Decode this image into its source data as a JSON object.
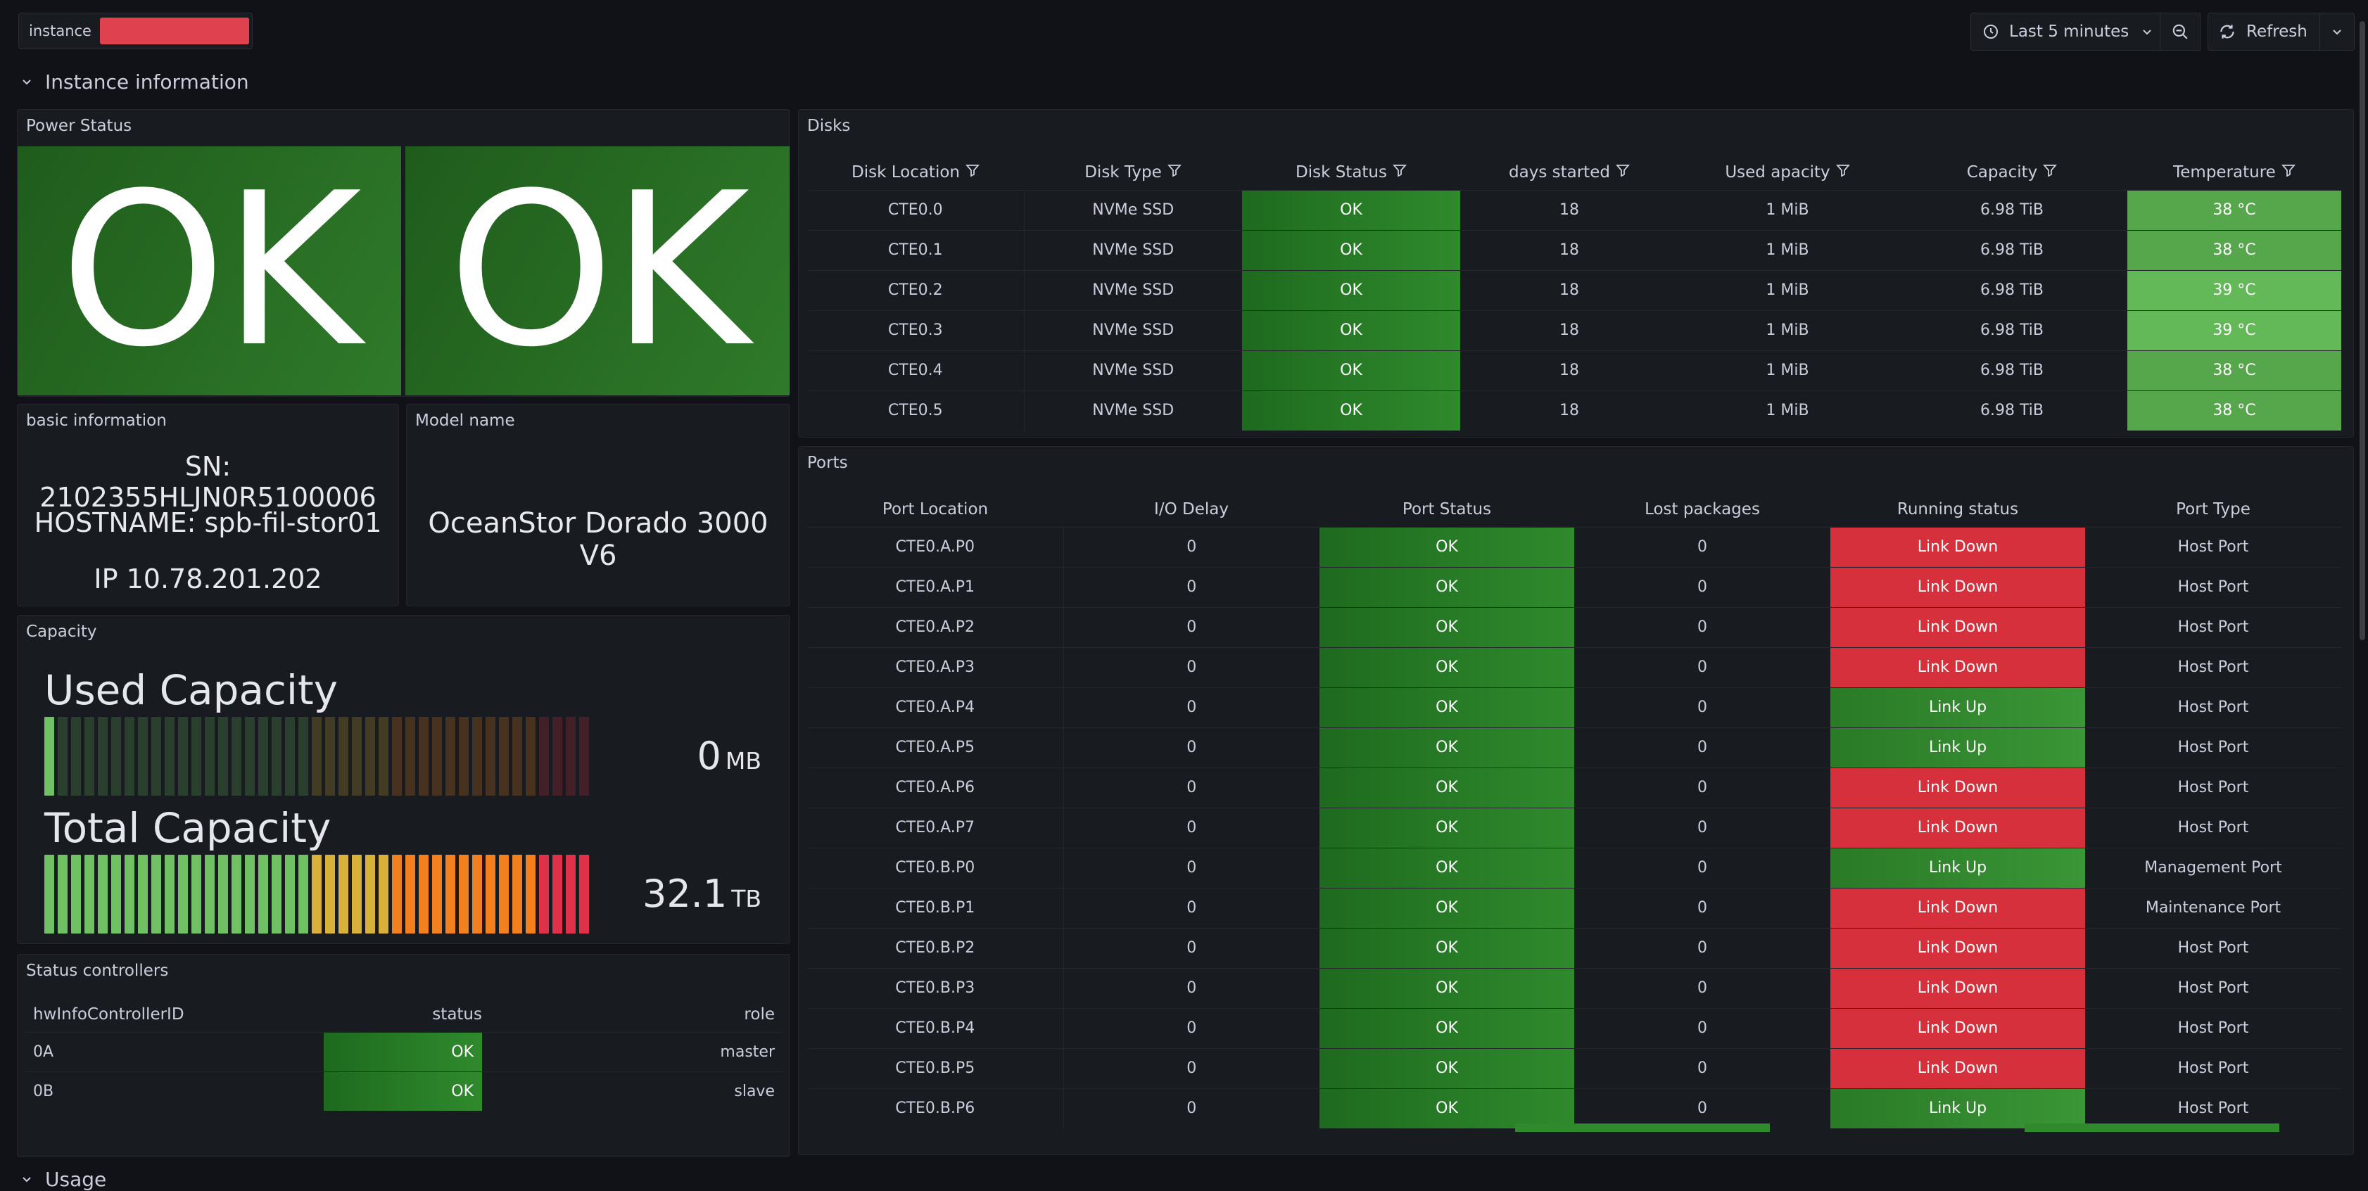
{
  "toolbar": {
    "variable_label": "instance",
    "time_range_label": "Last 5 minutes",
    "refresh_label": "Refresh"
  },
  "row": {
    "title": "Instance information",
    "next_title": "Usage"
  },
  "power_status": {
    "title": "Power Status",
    "tiles": [
      "OK",
      "OK"
    ]
  },
  "basic_info": {
    "title": "basic information",
    "sn": "SN: 2102355HLJN0R5100006",
    "hostname": "HOSTNAME: spb-fil-stor01",
    "ip": "IP 10.78.201.202"
  },
  "model": {
    "title": "Model name",
    "value": "OceanStor Dorado 3000 V6"
  },
  "capacity": {
    "title": "Capacity",
    "used_label": "Used Capacity",
    "used_value": "0",
    "used_unit": "MB",
    "used_fraction": 0.0,
    "total_label": "Total Capacity",
    "total_value": "32.1",
    "total_unit": "TB",
    "total_fraction": 1.0
  },
  "controllers": {
    "title": "Status controllers",
    "columns": [
      "hwInfoControllerID",
      "status",
      "role"
    ],
    "rows": [
      [
        "0A",
        "OK",
        "master"
      ],
      [
        "0B",
        "OK",
        "slave"
      ]
    ]
  },
  "disks": {
    "title": "Disks",
    "columns": [
      "Disk Location",
      "Disk Type",
      "Disk Status",
      "days started",
      "Used apacity",
      "Capacity",
      "Temperature"
    ],
    "rows": [
      [
        "CTE0.0",
        "NVMe SSD",
        "OK",
        "18",
        "1 MiB",
        "6.98 TiB",
        "38 °C"
      ],
      [
        "CTE0.1",
        "NVMe SSD",
        "OK",
        "18",
        "1 MiB",
        "6.98 TiB",
        "38 °C"
      ],
      [
        "CTE0.2",
        "NVMe SSD",
        "OK",
        "18",
        "1 MiB",
        "6.98 TiB",
        "39 °C"
      ],
      [
        "CTE0.3",
        "NVMe SSD",
        "OK",
        "18",
        "1 MiB",
        "6.98 TiB",
        "39 °C"
      ],
      [
        "CTE0.4",
        "NVMe SSD",
        "OK",
        "18",
        "1 MiB",
        "6.98 TiB",
        "38 °C"
      ],
      [
        "CTE0.5",
        "NVMe SSD",
        "OK",
        "18",
        "1 MiB",
        "6.98 TiB",
        "38 °C"
      ]
    ]
  },
  "ports": {
    "title": "Ports",
    "columns": [
      "Port Location",
      "I/O Delay",
      "Port Status",
      "Lost packages",
      "Running status",
      "Port Type"
    ],
    "rows": [
      [
        "CTE0.A.P0",
        "0",
        "OK",
        "0",
        "Link Down",
        "Host Port"
      ],
      [
        "CTE0.A.P1",
        "0",
        "OK",
        "0",
        "Link Down",
        "Host Port"
      ],
      [
        "CTE0.A.P2",
        "0",
        "OK",
        "0",
        "Link Down",
        "Host Port"
      ],
      [
        "CTE0.A.P3",
        "0",
        "OK",
        "0",
        "Link Down",
        "Host Port"
      ],
      [
        "CTE0.A.P4",
        "0",
        "OK",
        "0",
        "Link Up",
        "Host Port"
      ],
      [
        "CTE0.A.P5",
        "0",
        "OK",
        "0",
        "Link Up",
        "Host Port"
      ],
      [
        "CTE0.A.P6",
        "0",
        "OK",
        "0",
        "Link Down",
        "Host Port"
      ],
      [
        "CTE0.A.P7",
        "0",
        "OK",
        "0",
        "Link Down",
        "Host Port"
      ],
      [
        "CTE0.B.P0",
        "0",
        "OK",
        "0",
        "Link Up",
        "Management Port"
      ],
      [
        "CTE0.B.P1",
        "0",
        "OK",
        "0",
        "Link Down",
        "Maintenance Port"
      ],
      [
        "CTE0.B.P2",
        "0",
        "OK",
        "0",
        "Link Down",
        "Host Port"
      ],
      [
        "CTE0.B.P3",
        "0",
        "OK",
        "0",
        "Link Down",
        "Host Port"
      ],
      [
        "CTE0.B.P4",
        "0",
        "OK",
        "0",
        "Link Down",
        "Host Port"
      ],
      [
        "CTE0.B.P5",
        "0",
        "OK",
        "0",
        "Link Down",
        "Host Port"
      ],
      [
        "CTE0.B.P6",
        "0",
        "OK",
        "0",
        "Link Up",
        "Host Port"
      ]
    ]
  },
  "colors": {
    "ok_green": "#2f7a2a",
    "link_down_red": "#d6303d",
    "temp_green": "#56a64b",
    "background": "#111217",
    "panel": "#181b1f"
  }
}
